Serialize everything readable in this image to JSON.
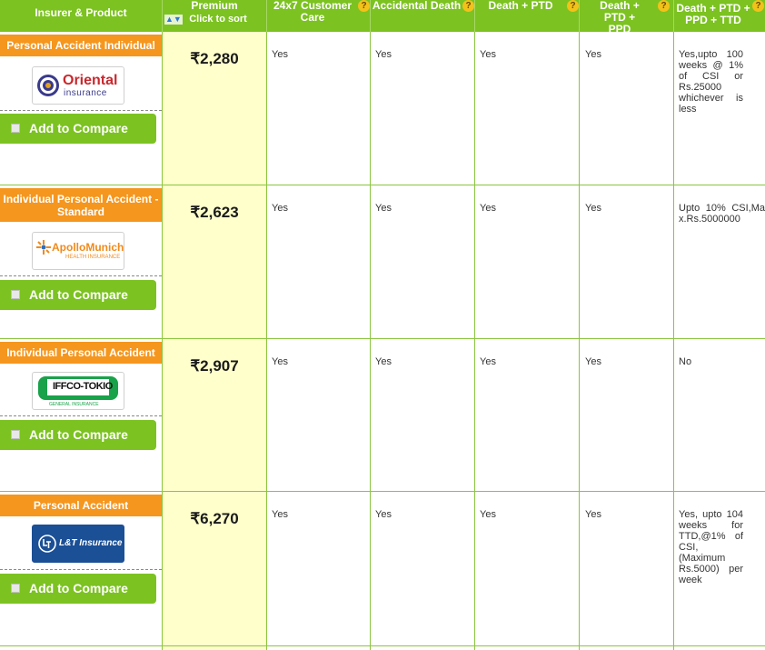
{
  "colors": {
    "accent": "#7cc221",
    "product_bar": "#f5961e",
    "premium_bg": "#ffffcc"
  },
  "header": {
    "insurer": "Insurer & Product",
    "premium": "Premium",
    "click_to_sort": "Click to sort",
    "sort_icon": "sort-arrows-icon",
    "customer_care": "24x7 Customer Care",
    "accidental_death": "Accidental Death",
    "death_ptd": "Death + PTD",
    "death_ptd_ppd": "Death + PTD + PPD",
    "death_ptd_ppd_ttd": "Death + PTD + PPD + TTD",
    "help_icon": "help-question-icon",
    "help_glyph": "?"
  },
  "currency": "₹",
  "compare_label": "Add to Compare",
  "rows": [
    {
      "product": "Personal Accident Individual",
      "insurer_logo": "Oriental Insurance",
      "logo_line1": "Oriental",
      "logo_line2": "insurance",
      "premium": "2,280",
      "customer_care": "Yes",
      "accidental_death": "Yes",
      "death_ptd": "Yes",
      "death_ptd_ppd": "Yes",
      "death_ptd_ppd_ttd": "Yes,upto 100 weeks @ 1% of CSI or Rs.25000 whichever is less"
    },
    {
      "product": "Individual Personal Accident - Standard",
      "insurer_logo": "Apollo Munich",
      "logo_line1": "ApolloMunich",
      "logo_line2": "HEALTH INSURANCE",
      "premium": "2,623",
      "customer_care": "Yes",
      "accidental_death": "Yes",
      "death_ptd": "Yes",
      "death_ptd_ppd": "Yes",
      "death_ptd_ppd_ttd": "Upto 10% CSI,Max.Rs.5000000"
    },
    {
      "product": "Individual Personal Accident",
      "insurer_logo": "IFFCO-TOKIO",
      "logo_line1": "IFFCO-TOKIO",
      "logo_line2": "GENERAL INSURANCE",
      "premium": "2,907",
      "customer_care": "Yes",
      "accidental_death": "Yes",
      "death_ptd": "Yes",
      "death_ptd_ppd": "Yes",
      "death_ptd_ppd_ttd": "No"
    },
    {
      "product": "Personal Accident",
      "insurer_logo": "L&T Insurance",
      "logo_line1": "L&T Insurance",
      "logo_line2": "",
      "premium": "6,270",
      "customer_care": "Yes",
      "accidental_death": "Yes",
      "death_ptd": "Yes",
      "death_ptd_ppd": "Yes",
      "death_ptd_ppd_ttd": "Yes, upto 104 weeks for TTD,@1% of CSI, (Maximum Rs.5000) per week"
    }
  ]
}
